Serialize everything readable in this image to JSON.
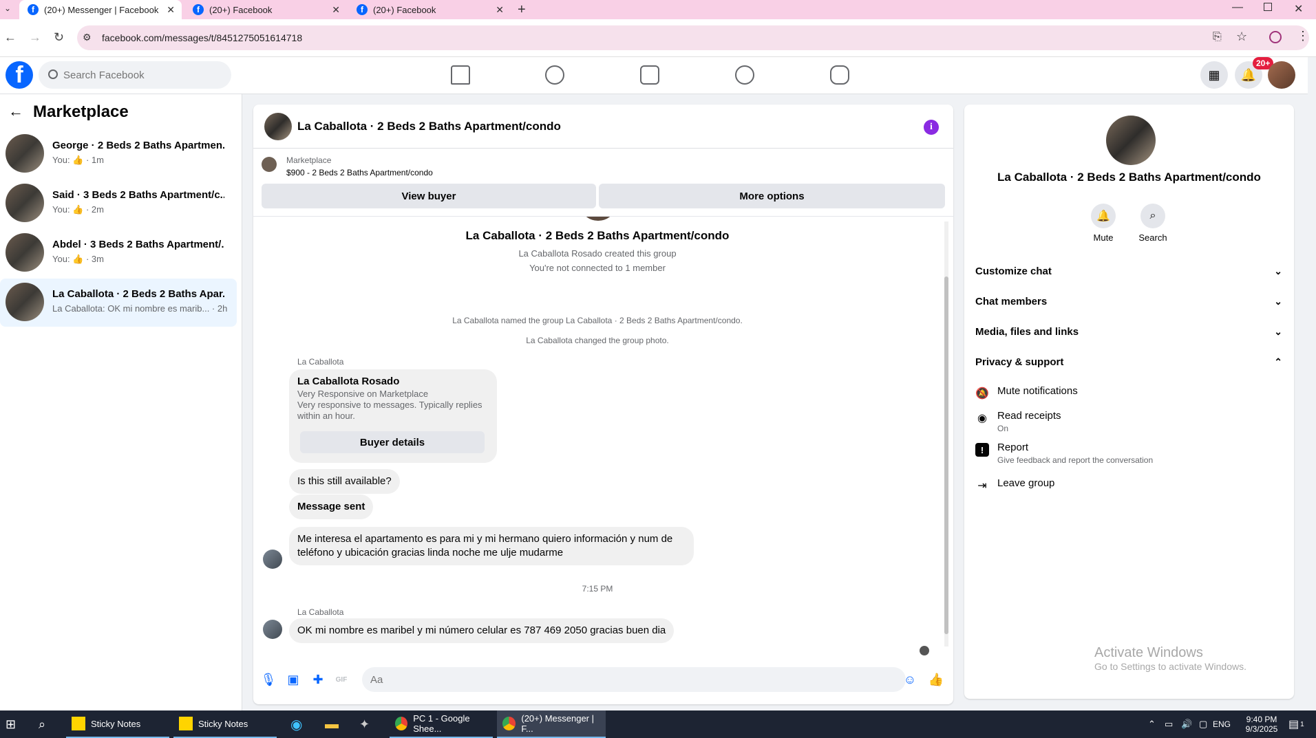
{
  "browser": {
    "tabs": [
      {
        "title": "(20+) Messenger | Facebook",
        "active": true
      },
      {
        "title": "(20+) Facebook",
        "active": false
      },
      {
        "title": "(20+) Facebook",
        "active": false
      }
    ],
    "new_tab": "+",
    "url": "facebook.com/messages/t/8451275051614718"
  },
  "header": {
    "search_placeholder": "Search Facebook",
    "notification_badge": "20+"
  },
  "left_panel": {
    "title": "Marketplace",
    "conversations": [
      {
        "name": "George · 2 Beds 2 Baths Apartmen...",
        "sub": "You: 👍 · 1m"
      },
      {
        "name": "Said · 3 Beds 2 Baths Apartment/c...",
        "sub": "You: 👍 · 2m"
      },
      {
        "name": "Abdel · 3 Beds 2 Baths Apartment/...",
        "sub": "You: 👍 · 3m"
      },
      {
        "name": "La Caballota · 2 Beds 2 Baths Apar...",
        "sub": "La Caballota: OK mi nombre es marib... · 2h"
      }
    ]
  },
  "chat": {
    "title": "La Caballota · 2 Beds 2 Baths Apartment/condo",
    "marketplace_label": "Marketplace",
    "listing": "$900 - 2 Beds 2 Baths Apartment/condo",
    "view_buyer": "View buyer",
    "more_options": "More options",
    "group_title": "La Caballota · 2 Beds 2 Baths Apartment/condo",
    "created": "La Caballota Rosado created this group",
    "not_connected": "You're not connected to 1 member",
    "named": "La Caballota named the group La Caballota · 2 Beds 2 Baths Apartment/condo.",
    "changed_photo": "La Caballota changed the group photo.",
    "sender1": "La Caballota",
    "card_name": "La Caballota Rosado",
    "card_line1": "Very Responsive on Marketplace",
    "card_line2": "Very responsive to messages. Typically replies within an hour.",
    "buyer_details": "Buyer details",
    "msg1": "Is this still available?",
    "msg2": "Message sent",
    "msg3": "Me interesa el apartamento es para mi y mi hermano quiero información y num de teléfono y ubicación gracias linda noche me ulje mudarme",
    "time": "7:15 PM",
    "sender2": "La Caballota",
    "msg4": "OK mi nombre es maribel y mi número celular es 787 469 2050 gracias buen dia",
    "composer_placeholder": "Aa"
  },
  "right_panel": {
    "title": "La Caballota · 2 Beds 2 Baths Apartment/condo",
    "mute": "Mute",
    "search": "Search",
    "sections": [
      "Customize chat",
      "Chat members",
      "Media, files and links",
      "Privacy & support"
    ],
    "mute_notifications": "Mute notifications",
    "read_receipts": "Read receipts",
    "read_receipts_state": "On",
    "report": "Report",
    "report_sub": "Give feedback and report the conversation",
    "leave_group": "Leave group",
    "activate_title": "Activate Windows",
    "activate_sub": "Go to Settings to activate Windows."
  },
  "taskbar": {
    "items": [
      "Sticky Notes",
      "Sticky Notes",
      "PC 1 - Google Shee...",
      "(20+) Messenger | F..."
    ],
    "lang": "ENG",
    "time": "9:40 PM",
    "date": "9/3/2025",
    "notif_count": "1"
  },
  "colors": {
    "fb_blue": "#0866ff",
    "tab_bar": "#f9d0e6",
    "selected_conv": "#ebf5ff",
    "info_purple": "#8a2be2",
    "badge_red": "#e41e3f"
  }
}
